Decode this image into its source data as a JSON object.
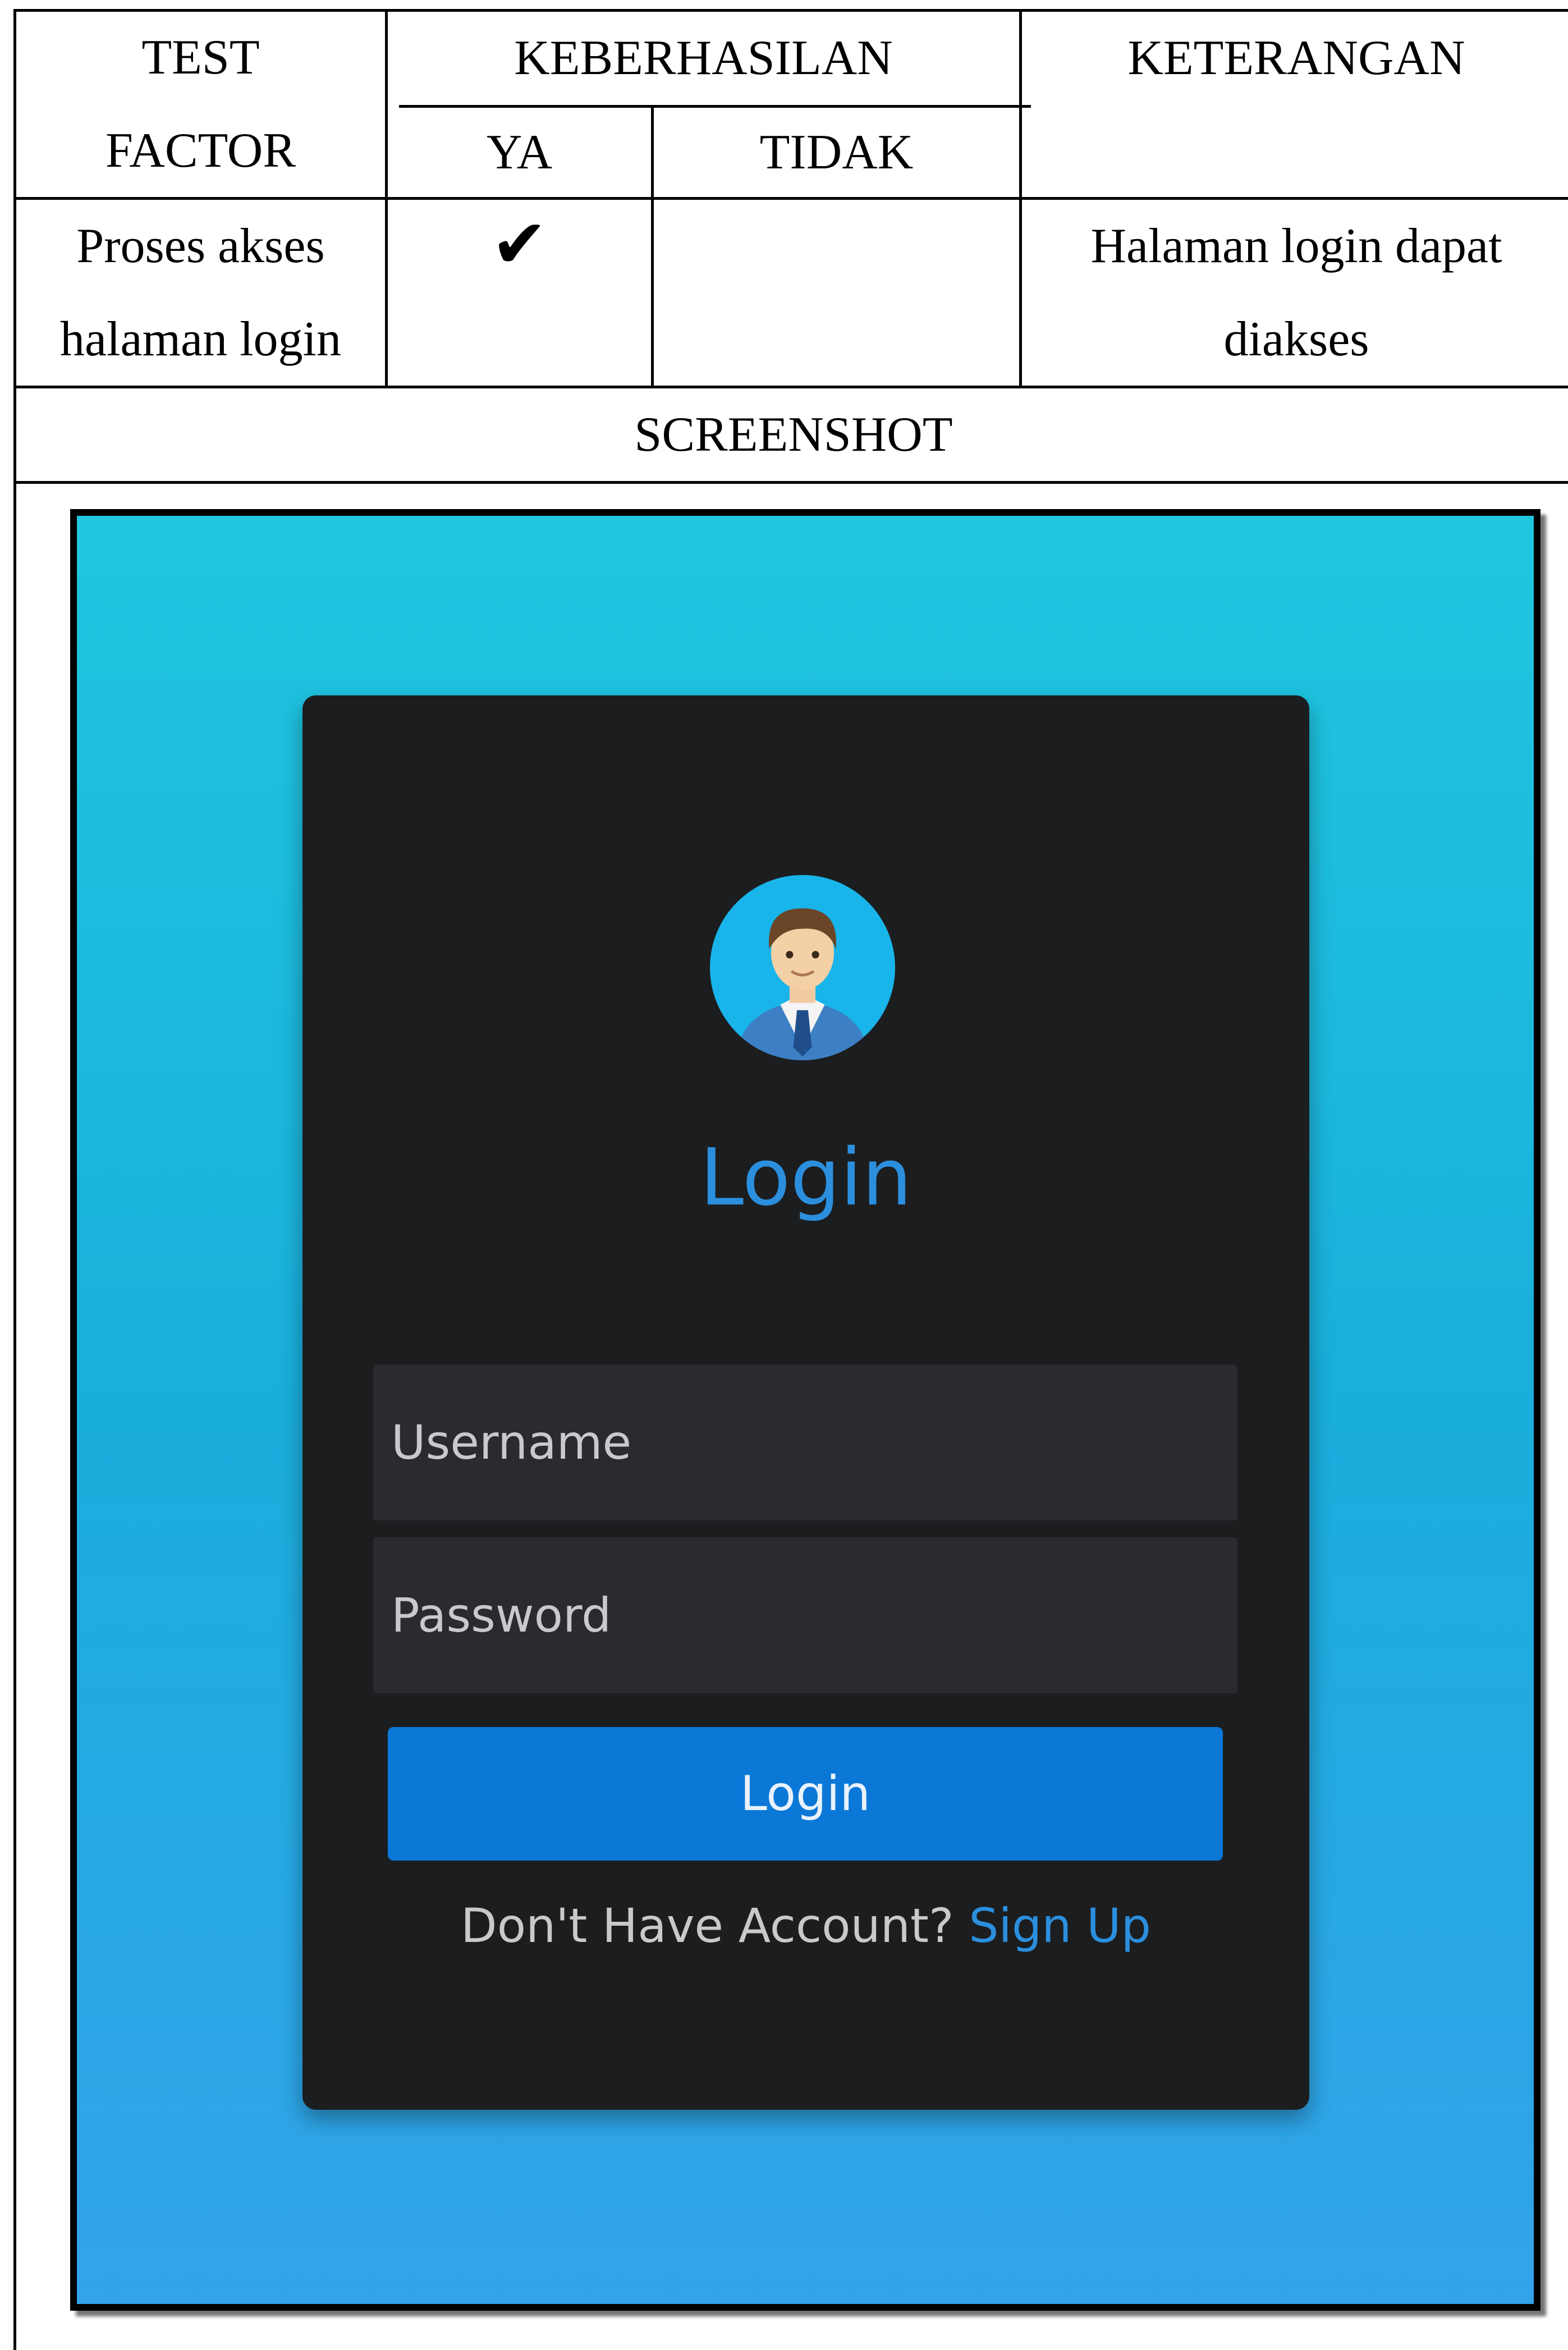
{
  "table": {
    "headers": {
      "test_factor_line1": "TEST",
      "test_factor_line2": "FACTOR",
      "keberhasilan": "KEBERHASILAN",
      "ya": "YA",
      "tidak": "TIDAK",
      "keterangan": "KETERANGAN"
    },
    "row": {
      "test_factor_line1": "Proses akses",
      "test_factor_line2": "halaman login",
      "ya_mark": "✔",
      "tidak_mark": "",
      "keterangan_line1": "Halaman login dapat",
      "keterangan_line2": "diakses"
    },
    "screenshot_label": "SCREENSHOT"
  },
  "screenshot": {
    "title": "Login",
    "username_placeholder": "Username",
    "password_placeholder": "Password",
    "login_button": "Login",
    "signup_prompt": "Don't Have Account?",
    "signup_link": "Sign Up",
    "avatar_icon": "user-avatar-icon",
    "colors": {
      "accent": "#2b8fde",
      "button": "#0b78d8",
      "card": "#1c1d1f",
      "field": "#2a2b2e",
      "background_top": "#1fc7df",
      "background_bottom": "#33a3ea"
    }
  }
}
